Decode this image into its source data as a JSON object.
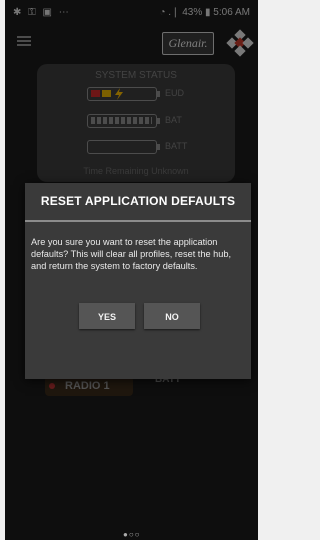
{
  "status_bar": {
    "left_icons": "✱ ⚿ ▣ ⋯",
    "right_text": "◔ .❘ 43% ▮ 5:06 AM"
  },
  "header": {
    "logo_text": "Glenair.",
    "menu_icon": "hamburger-icon",
    "brand_mark_icon": "diamond-cluster-icon"
  },
  "system_status": {
    "title": "SYSTEM STATUS",
    "eud_label": "EUD",
    "bat_label": "BAT",
    "batt_label": "BATT",
    "time_remaining": "Time Remaining Unknown"
  },
  "background": {
    "radio_label": "RADIO 1",
    "batt_label": "BATT"
  },
  "dialog": {
    "title": "RESET APPLICATION DEFAULTS",
    "message": "Are you sure you want to reset the application defaults? This will clear all profiles, reset the hub, and return the system to factory defaults.",
    "yes_label": "YES",
    "no_label": "NO"
  },
  "pager": {
    "dots": "●○○"
  },
  "colors": {
    "eud_red": "#c62828",
    "eud_yellow": "#e0b000",
    "bat_cells": "#8a8a8a",
    "charging_bolt": "#f2b400"
  }
}
